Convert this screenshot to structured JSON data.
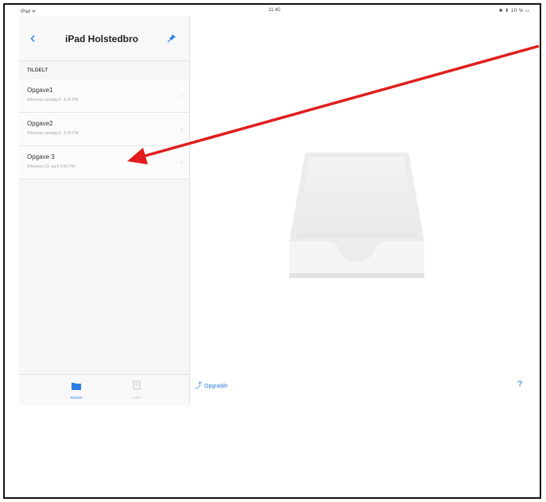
{
  "status_bar": {
    "left": "iPad ᯤ",
    "time": "11:40",
    "right": "✱ ⬆ 10 % ▭"
  },
  "sidebar": {
    "back_icon": "chevron-left-icon",
    "title": "iPad Holstedbro",
    "section_label": "TILDELT",
    "items": [
      {
        "name": "Opgave1",
        "subtitle": "Afleveres søndag 6. 4.20 PM"
      },
      {
        "name": "Opgave2",
        "subtitle": "Afleveres søndag 6. 4.20 PM"
      },
      {
        "name": "Opgave 3",
        "subtitle": "Afleveres 19. april 4.00 PM"
      }
    ],
    "tabs": [
      {
        "label": "Klasser",
        "icon": "folder-icon",
        "active": true
      },
      {
        "label": "Noter",
        "icon": "notes-icon",
        "active": false
      }
    ]
  },
  "main": {
    "upgrade_label": "Opgradér",
    "help_label": "?"
  },
  "colors": {
    "accent": "#2a7de1",
    "annotation_arrow": "#e11d1d"
  }
}
